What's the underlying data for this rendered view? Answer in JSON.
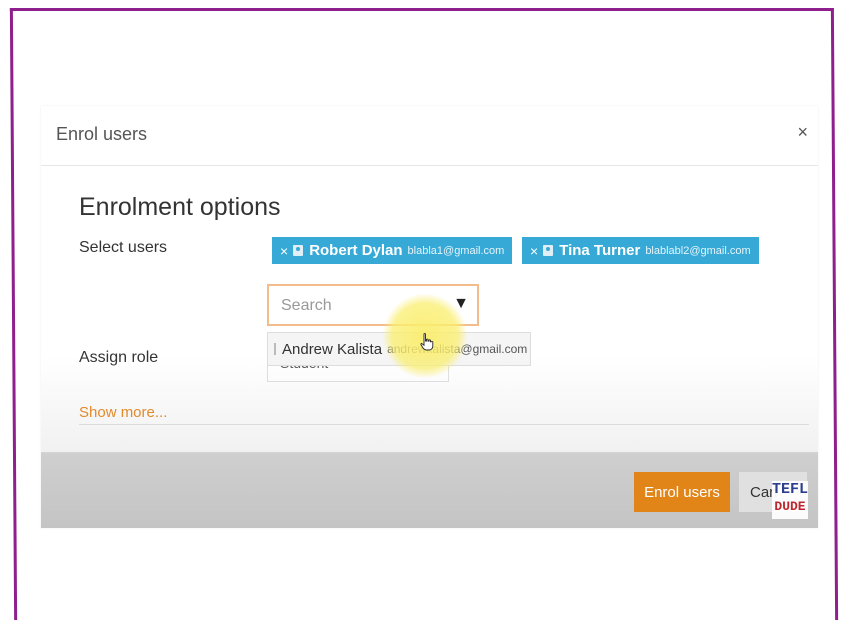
{
  "dialog": {
    "title": "Enrol users",
    "close_symbol": "×",
    "section_title": "Enrolment options",
    "select_users_label": "Select users",
    "assign_role_label": "Assign role",
    "show_more_label": "Show more...",
    "enrol_button_label": "Enrol users",
    "cancel_button_label": "Can"
  },
  "selected_users": [
    {
      "remove_symbol": "×",
      "name": "Robert Dylan",
      "email": "blabla1@gmail.com"
    },
    {
      "remove_symbol": "×",
      "name": "Tina Turner",
      "email": "blablabl2@gmail.com"
    }
  ],
  "search": {
    "placeholder": "Search",
    "value": "",
    "dropdown_symbol": "▼"
  },
  "suggestion": {
    "name": "Andrew Kalista",
    "email": "andrewkalista@gmail.com"
  },
  "role_select": {
    "selected": "Student"
  },
  "logo": {
    "line1": "TEFL",
    "line2": "DUDE"
  },
  "icons": {
    "user": "user-icon",
    "remove": "close-icon",
    "cursor": "hand-pointer-icon"
  },
  "colors": {
    "frame": "#8e1f8c",
    "chip": "#36a9d6",
    "primary_button": "#e18519",
    "link": "#e28a2b",
    "search_focus": "#f4bc8c",
    "highlight": "#faee6e"
  }
}
